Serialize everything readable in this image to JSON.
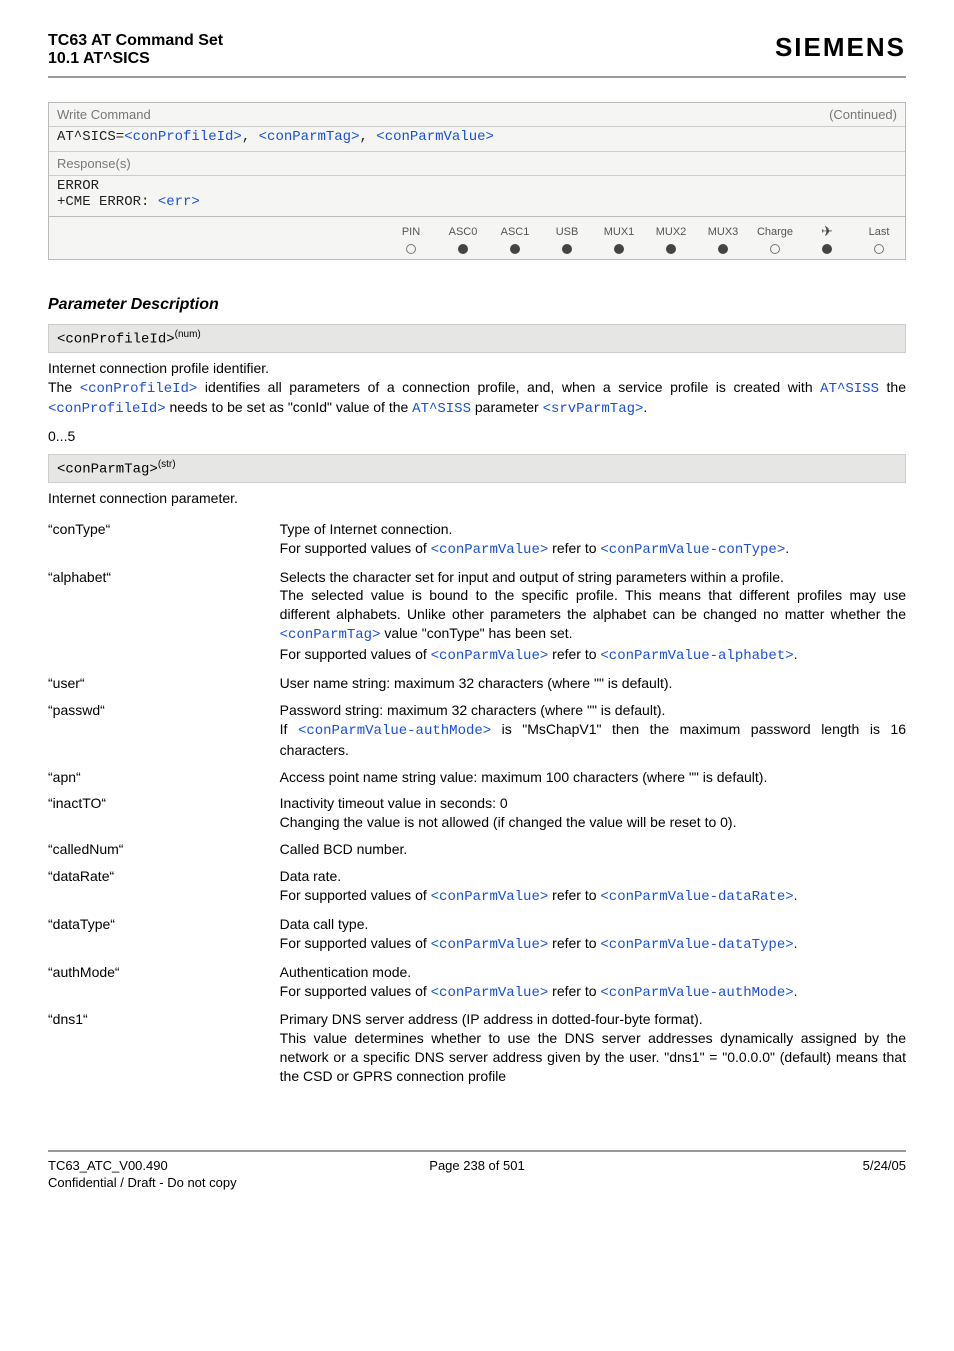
{
  "header": {
    "title_line1": "TC63 AT Command Set",
    "title_line2": "10.1 AT^SICS",
    "brand": "SIEMENS"
  },
  "cmdbox": {
    "write_label": "Write Command",
    "continued": "(Continued)",
    "syntax_prefix": "AT^SICS=",
    "p1": "<conProfileId>",
    "p2": "<conParmTag>",
    "p3": "<conParmValue>",
    "responses_label": "Response(s)",
    "resp_error": "ERROR",
    "resp_cme": "+CME ERROR: ",
    "resp_err": "<err>"
  },
  "if_headers": [
    "PIN",
    "ASC0",
    "ASC1",
    "USB",
    "MUX1",
    "MUX2",
    "MUX3",
    "Charge",
    "✈",
    "Last"
  ],
  "if_states": [
    "empty",
    "fill",
    "fill",
    "fill",
    "fill",
    "fill",
    "fill",
    "empty",
    "fill",
    "empty"
  ],
  "section_title": "Parameter Description",
  "param1": {
    "name": "<conProfileId>",
    "sup": "(num)",
    "line1": "Internet connection profile identifier.",
    "the": "The ",
    "link1": "<conProfileId>",
    "after1": " identifies all parameters of a connection profile, and, when a service profile is created with ",
    "link2": "AT^SISS",
    "after2": " the ",
    "link3": "<conProfileId>",
    "after3": " needs to be set as \"conId\" value of the ",
    "link4": "AT^SISS",
    "after4": " parameter ",
    "link5": "<srvParmTag>",
    "after5": ".",
    "range": "0...5"
  },
  "param2": {
    "name": "<conParmTag>",
    "sup": "(str)",
    "intro": "Internet connection parameter."
  },
  "tags": {
    "conType": {
      "label": "“conType“",
      "l1": "Type of Internet connection.",
      "l2a": "For supported values of ",
      "l2link1": "<conParmValue>",
      "l2b": " refer to ",
      "l2link2": "<conParmValue-conType>",
      "l2c": "."
    },
    "alphabet": {
      "label": "“alphabet“",
      "l1": "Selects the character set for input and output of string parameters within a profile.",
      "l2a": "The selected value is bound to the specific profile. This means that different profiles may use different alphabets. Unlike other parameters the alphabet can be changed no matter whether the ",
      "l2link1": "<conParmTag>",
      "l2b": " value \"conType\" has been set.",
      "l3a": "For supported values of ",
      "l3link1": "<conParmValue>",
      "l3b": " refer to ",
      "l3link2": "<conParmValue-alphabet>",
      "l3c": "."
    },
    "user": {
      "label": "“user“",
      "l1": "User name string: maximum 32 characters (where \"\" is default)."
    },
    "passwd": {
      "label": "“passwd“",
      "l1": "Password string: maximum 32 characters (where \"\" is default).",
      "l2a": "If ",
      "l2link1": "<conParmValue-authMode>",
      "l2b": " is \"MsChapV1\" then the maximum password length is 16 characters."
    },
    "apn": {
      "label": "“apn“",
      "l1": "Access point name string value: maximum 100 characters (where \"\" is default)."
    },
    "inactTO": {
      "label": "“inactTO“",
      "l1": "Inactivity timeout value in seconds: 0",
      "l2": "Changing the value is not allowed (if changed the value will be reset to 0)."
    },
    "calledNum": {
      "label": "“calledNum“",
      "l1": "Called BCD number."
    },
    "dataRate": {
      "label": "“dataRate“",
      "l1": "Data rate.",
      "l2a": "For supported values of ",
      "l2link1": "<conParmValue>",
      "l2b": " refer to ",
      "l2link2": "<conParmValue-dataRate>",
      "l2c": "."
    },
    "dataType": {
      "label": "“dataType“",
      "l1": "Data call type.",
      "l2a": "For supported values of ",
      "l2link1": "<conParmValue>",
      "l2b": " refer to ",
      "l2link2": "<conParmValue-dataType>",
      "l2c": "."
    },
    "authMode": {
      "label": "“authMode“",
      "l1": "Authentication mode.",
      "l2a": "For supported values of ",
      "l2link1": "<conParmValue>",
      "l2b": " refer to ",
      "l2link2": "<conParmValue-authMode>",
      "l2c": "."
    },
    "dns1": {
      "label": "“dns1“",
      "l1": "Primary DNS server address (IP address in dotted-four-byte format).",
      "l2": "This value determines whether to use the DNS server addresses dynamically assigned by the network or a specific DNS server address given by the user. \"dns1\" = \"0.0.0.0\" (default) means that the CSD or GPRS connection profile"
    }
  },
  "footer": {
    "left": "TC63_ATC_V00.490",
    "mid": "Page 238 of 501",
    "right": "5/24/05",
    "conf": "Confidential / Draft - Do not copy"
  }
}
